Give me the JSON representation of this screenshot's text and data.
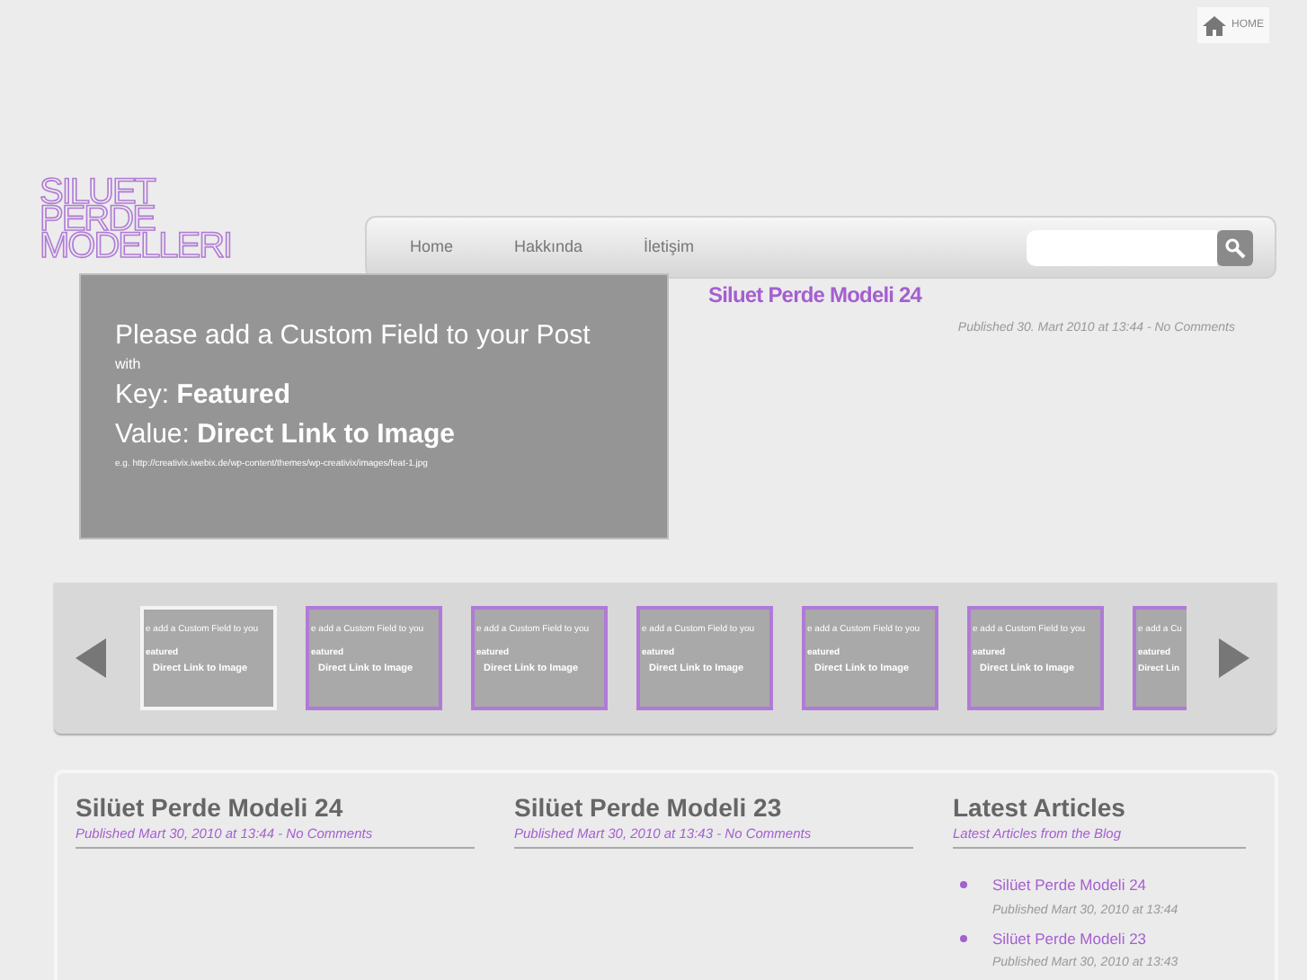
{
  "home_button": {
    "label": "HOME"
  },
  "logo": {
    "lines": [
      "SILUET",
      "PERDE",
      "MODELLERI"
    ]
  },
  "nav": {
    "items": [
      {
        "label": "Home"
      },
      {
        "label": "Hakkında"
      },
      {
        "label": "İletişim"
      }
    ]
  },
  "featured": {
    "notice": [
      "Please add a Custom Field to your Post",
      "with",
      "Key: **Featured**",
      "Value: **Direct Link to Image**",
      "e.g. http://creativix.iwebix.de/wp-content/themes/wp-creativix/images/feat-1.jpg"
    ],
    "title": "Siluet Perde Modeli 24",
    "meta": "Published 30. Mart 2010 at 13:44 - No Comments"
  },
  "carousel": {
    "thumbs": [
      {
        "lines": [
          "e add a Custom Field to you",
          "eatured",
          "Direct Link to Image"
        ],
        "selected": true
      },
      {
        "lines": [
          "e add a Custom Field to you",
          "eatured",
          "Direct Link to Image"
        ],
        "selected": false
      },
      {
        "lines": [
          "e add a Custom Field to you",
          "eatured",
          "Direct Link to Image"
        ],
        "selected": false
      },
      {
        "lines": [
          "e add a Custom Field to you",
          "eatured",
          "Direct Link to Image"
        ],
        "selected": false
      },
      {
        "lines": [
          "e add a Custom Field to you",
          "eatured",
          "Direct Link to Image"
        ],
        "selected": false
      },
      {
        "lines": [
          "e add a Custom Field to you",
          "eatured",
          "Direct Link to Image"
        ],
        "selected": false
      },
      {
        "lines": [
          "e add a Cu",
          "eatured",
          "Direct Lin"
        ],
        "selected": false,
        "partial": true
      }
    ]
  },
  "posts": [
    {
      "title": "Silüet Perde Modeli 24",
      "meta": "Published Mart 30, 2010 at 13:44 - No Comments"
    },
    {
      "title": "Silüet Perde Modeli 23",
      "meta": "Published Mart 30, 2010 at 13:43 - No Comments"
    }
  ],
  "latest": {
    "title": "Latest Articles",
    "subtitle": "Latest Articles from the Blog",
    "items": [
      {
        "title": "Silüet Perde Modeli 24",
        "meta": "Published Mart 30, 2010 at 13:44"
      },
      {
        "title": "Silüet Perde Modeli 23",
        "meta": "Published Mart 30, 2010 at 13:43"
      }
    ]
  }
}
